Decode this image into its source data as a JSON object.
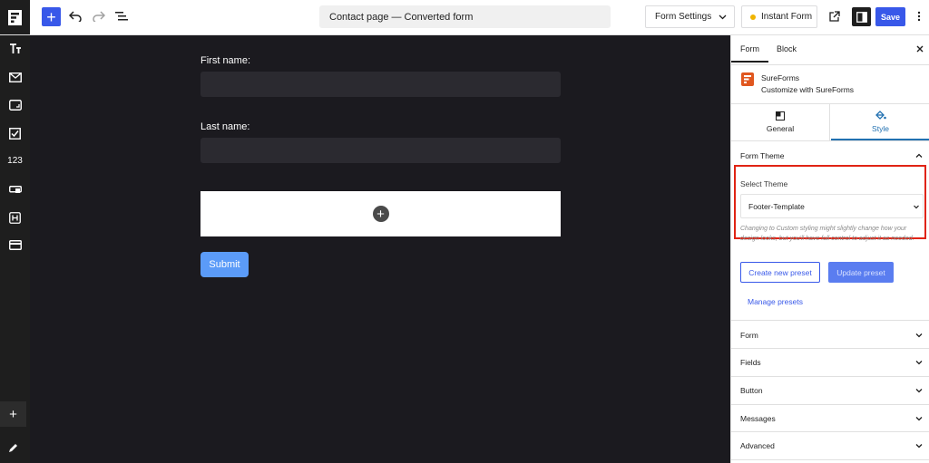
{
  "topbar": {
    "doc_title": "Contact page — Converted form",
    "form_settings_label": "Form Settings",
    "instant_form_label": "Instant Form",
    "save_label": "Save"
  },
  "leftrail": {
    "items": [
      "text-icon",
      "mail-icon",
      "input-icon",
      "checkbox-icon",
      "number-icon",
      "link-icon",
      "heading-icon",
      "card-icon"
    ],
    "number_label": "123"
  },
  "canvas": {
    "first_name_label": "First name:",
    "last_name_label": "Last name:",
    "submit_label": "Submit"
  },
  "panel": {
    "tabs": {
      "form": "Form",
      "block": "Block"
    },
    "sureforms_name": "SureForms",
    "sureforms_desc": "Customize with SureForms",
    "general_label": "General",
    "style_label": "Style",
    "form_theme_title": "Form Theme",
    "select_theme_label": "Select Theme",
    "selected_theme": "Footer-Template",
    "hint": "Changing to Custom styling might slightly change how your design looks, but you'll have full control to adjust it as needed.",
    "create_preset_label": "Create new preset",
    "update_preset_label": "Update preset",
    "manage_presets_label": "Manage presets",
    "sections": [
      "Form",
      "Fields",
      "Button",
      "Messages",
      "Advanced"
    ]
  },
  "colors": {
    "accent": "#3858e9",
    "highlight": "#e02414",
    "canvas_bg": "#1b1a1f",
    "submit": "#5b9bf8"
  }
}
